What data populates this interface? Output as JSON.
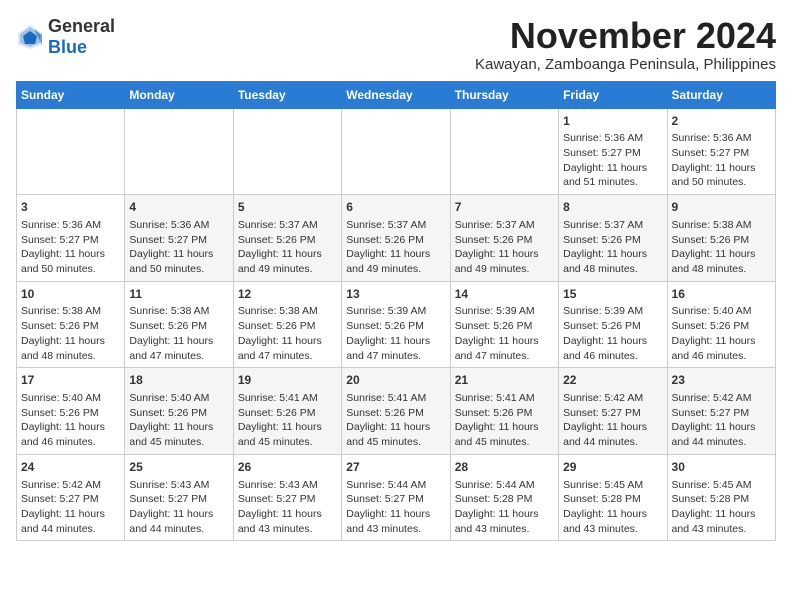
{
  "logo": {
    "text_general": "General",
    "text_blue": "Blue"
  },
  "header": {
    "month_year": "November 2024",
    "location": "Kawayan, Zamboanga Peninsula, Philippines"
  },
  "weekdays": [
    "Sunday",
    "Monday",
    "Tuesday",
    "Wednesday",
    "Thursday",
    "Friday",
    "Saturday"
  ],
  "weeks": [
    [
      {
        "day": "",
        "info": ""
      },
      {
        "day": "",
        "info": ""
      },
      {
        "day": "",
        "info": ""
      },
      {
        "day": "",
        "info": ""
      },
      {
        "day": "",
        "info": ""
      },
      {
        "day": "1",
        "info": "Sunrise: 5:36 AM\nSunset: 5:27 PM\nDaylight: 11 hours and 51 minutes."
      },
      {
        "day": "2",
        "info": "Sunrise: 5:36 AM\nSunset: 5:27 PM\nDaylight: 11 hours and 50 minutes."
      }
    ],
    [
      {
        "day": "3",
        "info": "Sunrise: 5:36 AM\nSunset: 5:27 PM\nDaylight: 11 hours and 50 minutes."
      },
      {
        "day": "4",
        "info": "Sunrise: 5:36 AM\nSunset: 5:27 PM\nDaylight: 11 hours and 50 minutes."
      },
      {
        "day": "5",
        "info": "Sunrise: 5:37 AM\nSunset: 5:26 PM\nDaylight: 11 hours and 49 minutes."
      },
      {
        "day": "6",
        "info": "Sunrise: 5:37 AM\nSunset: 5:26 PM\nDaylight: 11 hours and 49 minutes."
      },
      {
        "day": "7",
        "info": "Sunrise: 5:37 AM\nSunset: 5:26 PM\nDaylight: 11 hours and 49 minutes."
      },
      {
        "day": "8",
        "info": "Sunrise: 5:37 AM\nSunset: 5:26 PM\nDaylight: 11 hours and 48 minutes."
      },
      {
        "day": "9",
        "info": "Sunrise: 5:38 AM\nSunset: 5:26 PM\nDaylight: 11 hours and 48 minutes."
      }
    ],
    [
      {
        "day": "10",
        "info": "Sunrise: 5:38 AM\nSunset: 5:26 PM\nDaylight: 11 hours and 48 minutes."
      },
      {
        "day": "11",
        "info": "Sunrise: 5:38 AM\nSunset: 5:26 PM\nDaylight: 11 hours and 47 minutes."
      },
      {
        "day": "12",
        "info": "Sunrise: 5:38 AM\nSunset: 5:26 PM\nDaylight: 11 hours and 47 minutes."
      },
      {
        "day": "13",
        "info": "Sunrise: 5:39 AM\nSunset: 5:26 PM\nDaylight: 11 hours and 47 minutes."
      },
      {
        "day": "14",
        "info": "Sunrise: 5:39 AM\nSunset: 5:26 PM\nDaylight: 11 hours and 47 minutes."
      },
      {
        "day": "15",
        "info": "Sunrise: 5:39 AM\nSunset: 5:26 PM\nDaylight: 11 hours and 46 minutes."
      },
      {
        "day": "16",
        "info": "Sunrise: 5:40 AM\nSunset: 5:26 PM\nDaylight: 11 hours and 46 minutes."
      }
    ],
    [
      {
        "day": "17",
        "info": "Sunrise: 5:40 AM\nSunset: 5:26 PM\nDaylight: 11 hours and 46 minutes."
      },
      {
        "day": "18",
        "info": "Sunrise: 5:40 AM\nSunset: 5:26 PM\nDaylight: 11 hours and 45 minutes."
      },
      {
        "day": "19",
        "info": "Sunrise: 5:41 AM\nSunset: 5:26 PM\nDaylight: 11 hours and 45 minutes."
      },
      {
        "day": "20",
        "info": "Sunrise: 5:41 AM\nSunset: 5:26 PM\nDaylight: 11 hours and 45 minutes."
      },
      {
        "day": "21",
        "info": "Sunrise: 5:41 AM\nSunset: 5:26 PM\nDaylight: 11 hours and 45 minutes."
      },
      {
        "day": "22",
        "info": "Sunrise: 5:42 AM\nSunset: 5:27 PM\nDaylight: 11 hours and 44 minutes."
      },
      {
        "day": "23",
        "info": "Sunrise: 5:42 AM\nSunset: 5:27 PM\nDaylight: 11 hours and 44 minutes."
      }
    ],
    [
      {
        "day": "24",
        "info": "Sunrise: 5:42 AM\nSunset: 5:27 PM\nDaylight: 11 hours and 44 minutes."
      },
      {
        "day": "25",
        "info": "Sunrise: 5:43 AM\nSunset: 5:27 PM\nDaylight: 11 hours and 44 minutes."
      },
      {
        "day": "26",
        "info": "Sunrise: 5:43 AM\nSunset: 5:27 PM\nDaylight: 11 hours and 43 minutes."
      },
      {
        "day": "27",
        "info": "Sunrise: 5:44 AM\nSunset: 5:27 PM\nDaylight: 11 hours and 43 minutes."
      },
      {
        "day": "28",
        "info": "Sunrise: 5:44 AM\nSunset: 5:28 PM\nDaylight: 11 hours and 43 minutes."
      },
      {
        "day": "29",
        "info": "Sunrise: 5:45 AM\nSunset: 5:28 PM\nDaylight: 11 hours and 43 minutes."
      },
      {
        "day": "30",
        "info": "Sunrise: 5:45 AM\nSunset: 5:28 PM\nDaylight: 11 hours and 43 minutes."
      }
    ]
  ]
}
